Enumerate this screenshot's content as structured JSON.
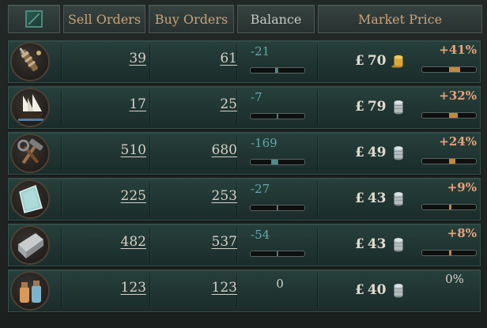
{
  "header": {
    "sell_orders": "Sell Orders",
    "buy_orders": "Buy Orders",
    "balance": "Balance",
    "market_price": "Market Price"
  },
  "rows": [
    {
      "good_icon": "small-arms-icon",
      "sell": "39",
      "buy": "61",
      "balance": "-21",
      "balance_fill": -0.08,
      "currency": "£",
      "price": "70",
      "coin_icon": "gold-coins-icon",
      "change": "+41%",
      "change_fill": 0.41
    },
    {
      "good_icon": "clipper-ship-icon",
      "sell": "17",
      "buy": "25",
      "balance": "-7",
      "balance_fill": -0.03,
      "currency": "£",
      "price": "79",
      "coin_icon": "silver-coins-icon",
      "change": "+32%",
      "change_fill": 0.32
    },
    {
      "good_icon": "tools-icon",
      "sell": "510",
      "buy": "680",
      "balance": "-169",
      "balance_fill": -0.25,
      "currency": "£",
      "price": "49",
      "coin_icon": "silver-coins-icon",
      "change": "+24%",
      "change_fill": 0.24
    },
    {
      "good_icon": "glass-icon",
      "sell": "225",
      "buy": "253",
      "balance": "-27",
      "balance_fill": -0.02,
      "currency": "£",
      "price": "43",
      "coin_icon": "silver-coins-icon",
      "change": "+9%",
      "change_fill": 0.09
    },
    {
      "good_icon": "steel-icon",
      "sell": "482",
      "buy": "537",
      "balance": "-54",
      "balance_fill": -0.02,
      "currency": "£",
      "price": "43",
      "coin_icon": "silver-coins-icon",
      "change": "+8%",
      "change_fill": 0.08
    },
    {
      "good_icon": "medicine-icon",
      "sell": "123",
      "buy": "123",
      "balance": "0",
      "balance_fill": 0,
      "currency": "£",
      "price": "40",
      "coin_icon": "silver-coins-icon",
      "change": "0%",
      "change_fill": 0
    }
  ],
  "colors": {
    "header_text": "#c9a27b",
    "balance_negative": "#63a6ad",
    "change_positive": "#e6a27c",
    "price_bar": "#c38a3c",
    "balance_bar": "#4f8a8e"
  }
}
